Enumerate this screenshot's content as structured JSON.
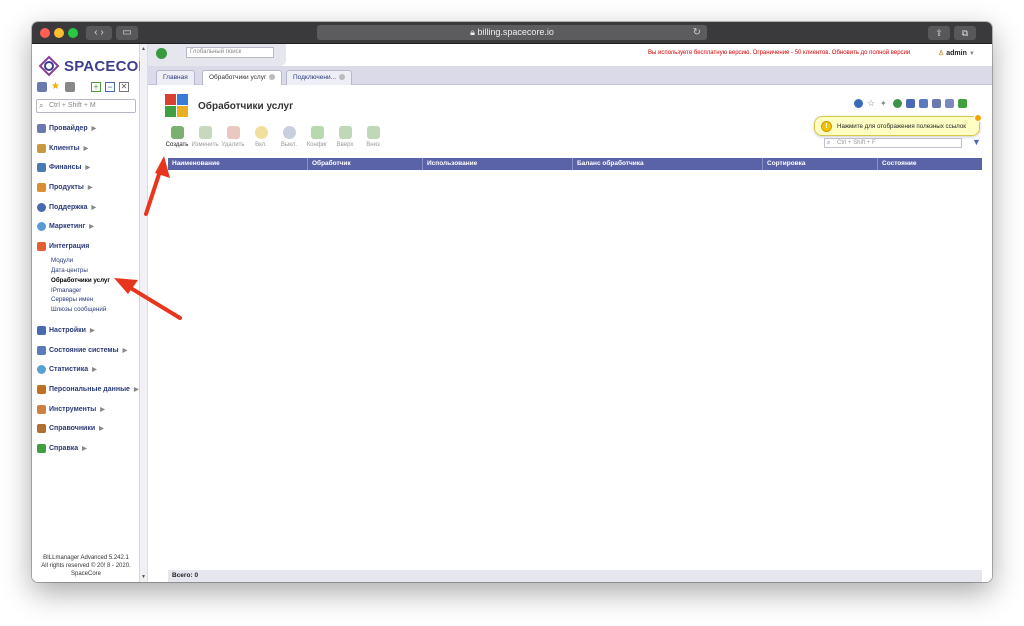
{
  "browser": {
    "url": "billing.spacecore.io"
  },
  "app": {
    "logo_text": "SPACECORE",
    "global_search_placeholder": "Глобальный поиск",
    "warning": "Вы используете бесплатную версию. Ограничение - 50 клиентов. Обновить до полной версии",
    "user": "admin"
  },
  "sidebar": {
    "search_placeholder": "Ctrl + Shift + M",
    "menu": [
      {
        "label": "Провайдер",
        "icon": "provider-icon",
        "color": "#6a7ab0"
      },
      {
        "label": "Клиенты",
        "icon": "clients-icon",
        "color": "#c89a40"
      },
      {
        "label": "Финансы",
        "icon": "finance-icon",
        "color": "#4a7ab0"
      },
      {
        "label": "Продукты",
        "icon": "products-icon",
        "color": "#d89030"
      },
      {
        "label": "Поддержка",
        "icon": "support-icon",
        "color": "#4a6ab0"
      },
      {
        "label": "Маркетинг",
        "icon": "marketing-icon",
        "color": "#5a9ad8"
      },
      {
        "label": "Интеграция",
        "icon": "integration-icon",
        "color": "#e06030"
      }
    ],
    "integration_sub": [
      "Модули",
      "Дата-центры",
      "Обработчики услуг",
      "IPmanager",
      "Серверы имен",
      "Шлюзы сообщений"
    ],
    "menu2": [
      {
        "label": "Настройки",
        "icon": "settings-icon",
        "color": "#4a6ab0"
      },
      {
        "label": "Состояние системы",
        "icon": "system-status-icon",
        "color": "#5a7ab8"
      },
      {
        "label": "Статистика",
        "icon": "statistics-icon",
        "color": "#5aa0d0"
      },
      {
        "label": "Персональные данные",
        "icon": "personal-data-icon",
        "color": "#c07020"
      },
      {
        "label": "Инструменты",
        "icon": "tools-icon",
        "color": "#d08040"
      },
      {
        "label": "Справочники",
        "icon": "directories-icon",
        "color": "#b07030"
      },
      {
        "label": "Справка",
        "icon": "help-icon",
        "color": "#40a040"
      }
    ],
    "footer_line1": "BILLmanager Advanced 5.242.1",
    "footer_line2": "All rights reserved © 20! 8 - 2020.",
    "footer_line3": "SpaceCore"
  },
  "tabs": [
    {
      "label": "Главная"
    },
    {
      "label": "Обработчики услуг"
    },
    {
      "label": "Подключени..."
    }
  ],
  "page": {
    "title": "Обработчики услуг",
    "tooltip": "Нажмите для отображения полезных ссылок",
    "filter_placeholder": "Ctrl + Shift + F",
    "total": "Всего: 0"
  },
  "toolbar": [
    {
      "label": "Создать",
      "enabled": true,
      "color": "#7ab070"
    },
    {
      "label": "Изменить",
      "enabled": false,
      "color": "#c8d8c0"
    },
    {
      "label": "Удалить",
      "enabled": false,
      "color": "#e8c8c0"
    },
    {
      "label": "Вкл.",
      "enabled": false,
      "color": "#f0e0a0"
    },
    {
      "label": "Выкл.",
      "enabled": false,
      "color": "#c8d0e0"
    },
    {
      "label": "Конфиг",
      "enabled": false,
      "color": "#b8d8b0"
    },
    {
      "label": "Вверх",
      "enabled": false,
      "color": "#c0d8b8"
    },
    {
      "label": "Вниз",
      "enabled": false,
      "color": "#c0d8b8"
    }
  ],
  "table": {
    "columns": [
      "Наименование",
      "Обработчик",
      "Использование",
      "Баланс обработчика",
      "Сортировка",
      "Состояние"
    ]
  }
}
